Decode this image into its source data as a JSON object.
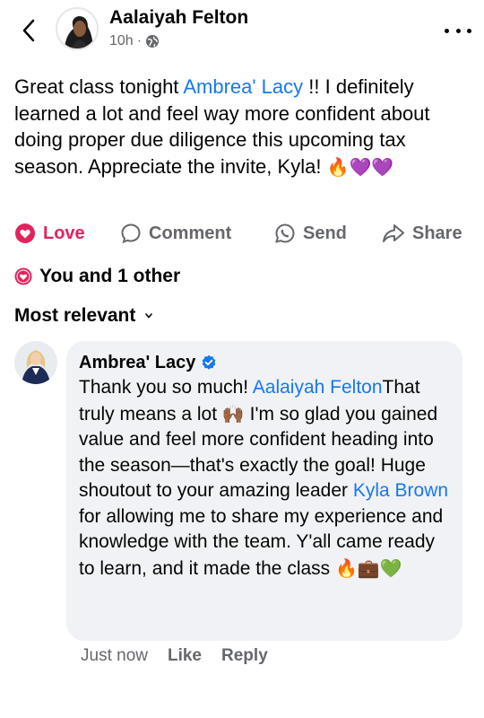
{
  "post": {
    "author": "Aalaiyah Felton",
    "time": "10h",
    "separator": "·",
    "audience_icon": "globe-icon",
    "text_before": "Great class tonight ",
    "mention": "Ambrea' Lacy",
    "text_after": " !! I definitely learned a lot and feel way more confident about doing proper due diligence this upcoming tax season. Appreciate the invite, Kyla! ",
    "emojis": "🔥💜💜"
  },
  "actions": {
    "love": "Love",
    "comment": "Comment",
    "send": "Send",
    "share": "Share",
    "love_active": true
  },
  "reactions": {
    "summary": "You and 1 other"
  },
  "comments_sort": {
    "label": "Most relevant"
  },
  "comment": {
    "author": "Ambrea' Lacy",
    "verified": true,
    "text_intro": "Thank you so much! ",
    "mention1": "Aalaiyah Felton",
    "text_mid": "That truly means a lot ",
    "emoji1": "🙌🏾",
    "text_body": " I'm so glad you gained value and feel more confident heading into the season—that's exactly the goal! Huge shoutout to your amazing leader ",
    "mention2": "Kyla Brown",
    "text_end": " for allowing me to share my experience and knowledge with the team. Y'all came ready to learn, and it made the class ",
    "emoji2": "🔥💼💚",
    "time": "Just now",
    "like": "Like",
    "reply": "Reply"
  },
  "colors": {
    "link": "#1877f2",
    "love": "#e0245e",
    "muted": "#65676b",
    "bubble": "#f0f2f5"
  }
}
